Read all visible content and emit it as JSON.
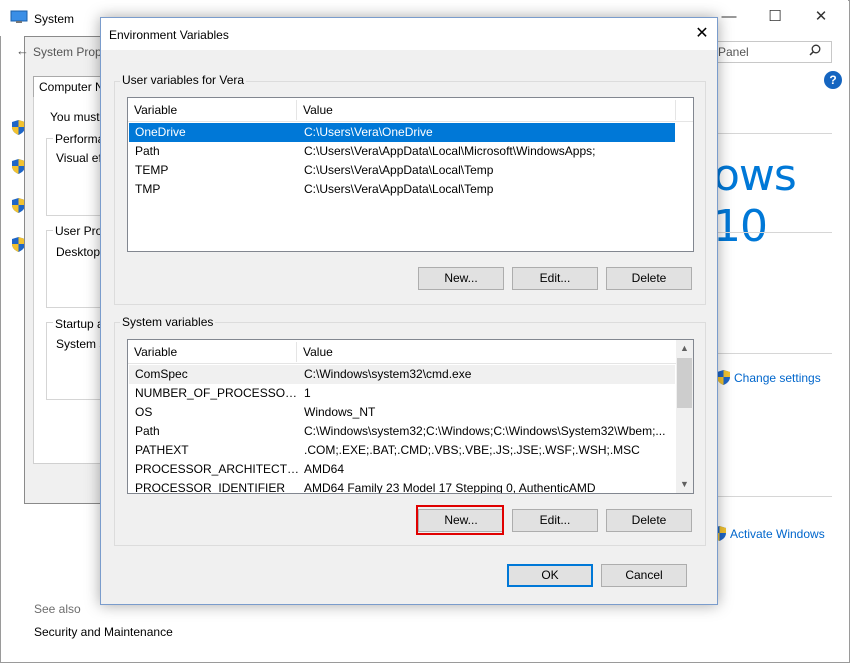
{
  "system_window": {
    "title": "System",
    "search_placeholder": "Panel",
    "windows_logo_text": "ows 10",
    "change_settings": "Change settings",
    "activate_windows": "Activate Windows",
    "see_also": "See also",
    "security_and_maintenance": "Security and Maintenance",
    "controls": {
      "minimize": "—",
      "maximize": "☐",
      "close": "✕"
    }
  },
  "system_properties": {
    "title": "System Prop",
    "tab_label": "Computer Na",
    "must_text": "You must b",
    "performance_label": "Performar",
    "visual_effects_text": "Visual effe",
    "user_profiles_label": "User Profi",
    "desktop_text": "Desktop s",
    "startup_label": "Startup ar",
    "system_startup_text": "System st"
  },
  "env_dialog": {
    "title": "Environment Variables",
    "close_glyph": "✕",
    "user_section": {
      "label": "User variables for Vera",
      "columns": [
        "Variable",
        "Value"
      ],
      "rows": [
        {
          "variable": "OneDrive",
          "value": "C:\\Users\\Vera\\OneDrive",
          "selected": true
        },
        {
          "variable": "Path",
          "value": "C:\\Users\\Vera\\AppData\\Local\\Microsoft\\WindowsApps;"
        },
        {
          "variable": "TEMP",
          "value": "C:\\Users\\Vera\\AppData\\Local\\Temp"
        },
        {
          "variable": "TMP",
          "value": "C:\\Users\\Vera\\AppData\\Local\\Temp"
        }
      ],
      "buttons": {
        "new": "New...",
        "edit": "Edit...",
        "delete": "Delete"
      }
    },
    "system_section": {
      "label": "System variables",
      "columns": [
        "Variable",
        "Value"
      ],
      "rows": [
        {
          "variable": "ComSpec",
          "value": "C:\\Windows\\system32\\cmd.exe"
        },
        {
          "variable": "NUMBER_OF_PROCESSORS",
          "value": "1"
        },
        {
          "variable": "OS",
          "value": "Windows_NT"
        },
        {
          "variable": "Path",
          "value": "C:\\Windows\\system32;C:\\Windows;C:\\Windows\\System32\\Wbem;..."
        },
        {
          "variable": "PATHEXT",
          "value": ".COM;.EXE;.BAT;.CMD;.VBS;.VBE;.JS;.JSE;.WSF;.WSH;.MSC"
        },
        {
          "variable": "PROCESSOR_ARCHITECTURE",
          "value": "AMD64"
        },
        {
          "variable": "PROCESSOR_IDENTIFIER",
          "value": "AMD64 Family 23 Model 17 Stepping 0, AuthenticAMD"
        }
      ],
      "buttons": {
        "new": "New...",
        "edit": "Edit...",
        "delete": "Delete"
      },
      "scroll": {
        "up": "▲",
        "down": "▼"
      }
    },
    "ok_label": "OK",
    "cancel_label": "Cancel"
  },
  "colors": {
    "selection": "#0078d7",
    "highlight_box": "#e00000",
    "link": "#0066cc"
  }
}
